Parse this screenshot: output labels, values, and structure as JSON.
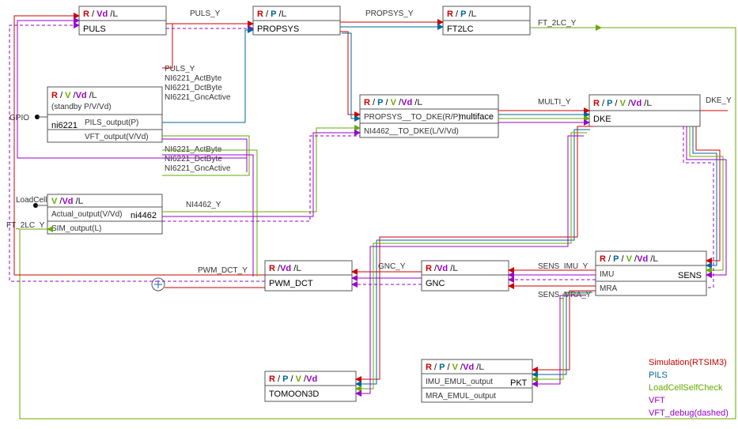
{
  "legend": {
    "sim": "Simulation(RTSIM3)",
    "pils": "PILS",
    "lc": "LoadCellSelfCheck",
    "vft": "VFT",
    "vftd": "VFT_debug(dashed)"
  },
  "edges": {
    "puls_y": "PULS_Y",
    "propsys_y": "PROPSYS_Y",
    "ft2lc_y": "FT_2LC_Y",
    "multi_y": "MULTI_Y",
    "dke_y": "DKE_Y",
    "pwm_dct_y": "PWM_DCT_Y",
    "gnc_y": "GNC_Y",
    "sens_imu_y": "SENS_IMU_Y",
    "sens_mra_y": "SENS_MRA_Y",
    "ni4462_y": "NI4462_Y",
    "gpio": "GPIO",
    "loadcell": "LoadCell",
    "ft2lc_in": "FT_2LC_Y"
  },
  "blocks": {
    "puls": {
      "title": "PULS",
      "modes": [
        "R",
        "Vd",
        "L"
      ]
    },
    "propsys": {
      "title": "PROPSYS",
      "modes": [
        "R",
        "P",
        "L"
      ]
    },
    "ft2lc": {
      "title": "FT2LC",
      "modes": [
        "R",
        "P",
        "L"
      ]
    },
    "ni6221": {
      "title": "ni6221",
      "modes": [
        "R",
        "V",
        "Vd",
        "L"
      ],
      "subtitle": "(standby P/V/Vd)",
      "ports_in": [
        "PULS_Y",
        "NI6221_ActByte",
        "NI6221_DctByte",
        "NI6221_GncActive"
      ],
      "ports_r1": "PILS_output(P)",
      "ports_r2": "VFT_output(V/Vd)",
      "ports_out": [
        "NI6221_ActByte",
        "NI6221_DctByte",
        "NI6221_GncActive"
      ]
    },
    "multiface": {
      "title": "multiface",
      "modes": [
        "R",
        "P",
        "V",
        "Vd",
        "L"
      ],
      "r1": "PROPSYS__TO_DKE(R/P)",
      "r2": "NI4462__TO_DKE(L/V/Vd)"
    },
    "dke": {
      "title": "DKE",
      "modes": [
        "R",
        "P",
        "V",
        "Vd",
        "L"
      ]
    },
    "ni4462": {
      "title": "ni4462",
      "modes": [
        "V",
        "Vd",
        "L"
      ],
      "r1": "Actual_output(V/Vd)",
      "r2": "SIM_output(L)"
    },
    "pwmdct": {
      "title": "PWM_DCT",
      "modes": [
        "R",
        "Vd",
        "L"
      ]
    },
    "gnc": {
      "title": "GNC",
      "modes": [
        "R",
        "Vd",
        "L"
      ]
    },
    "sens": {
      "title": "SENS",
      "modes": [
        "R",
        "P",
        "V",
        "Vd",
        "L"
      ],
      "r1": "IMU",
      "r2": "MRA"
    },
    "tomoon": {
      "title": "TOMOON3D",
      "modes": [
        "R",
        "P",
        "V",
        "Vd"
      ]
    },
    "pkt": {
      "title": "PKT",
      "modes": [
        "R",
        "P",
        "V",
        "Vd",
        "L"
      ],
      "r1": "IMU_EMUL_output",
      "r2": "MRA_EMUL_output"
    }
  }
}
